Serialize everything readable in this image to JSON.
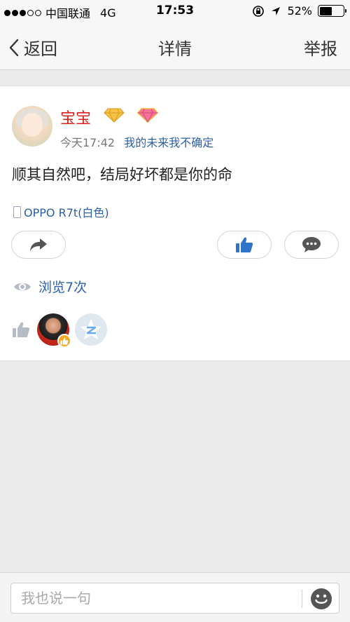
{
  "status_bar": {
    "carrier": "中国联通",
    "network": "4G",
    "time": "17:53",
    "battery_percent": "52%",
    "battery_level": 0.52
  },
  "nav": {
    "back_label": "返回",
    "title": "详情",
    "report_label": "举报"
  },
  "post": {
    "username": "宝宝",
    "time": "今天17:42",
    "signature": "我的未来我不确定",
    "content": "顺其自然吧，结局好坏都是你的命",
    "device": "OPPO R7t(白色)",
    "views": "浏览7次"
  },
  "comment": {
    "placeholder": "我也说一句"
  },
  "colors": {
    "username": "#d9201b",
    "link": "#2d5fa8",
    "background": "#ebebeb"
  }
}
